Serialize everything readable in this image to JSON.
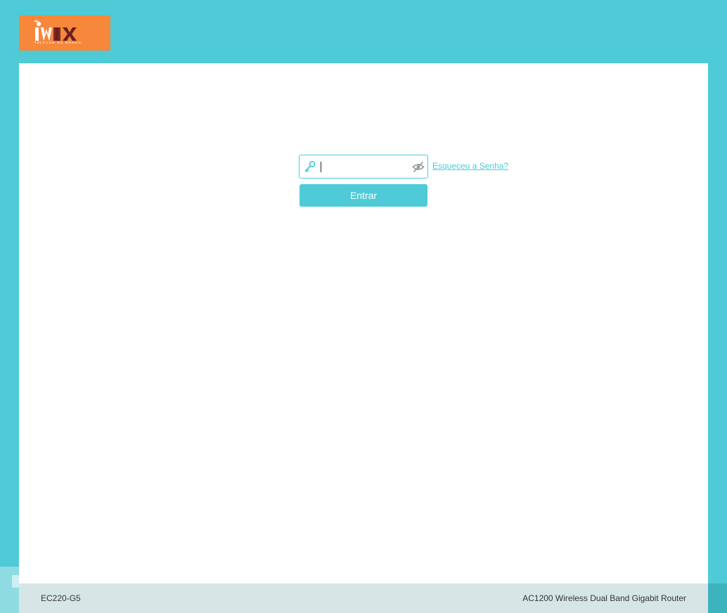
{
  "brand": {
    "logo_text": "IWIX",
    "logo_subtext": "TELECOM DO BRASIL",
    "logo_color": "#f6873b"
  },
  "theme": {
    "accent_color": "#4ecbd6",
    "background_color": "#4ecbd6",
    "panel_color": "#ffffff",
    "footer_color": "#d6e6e7"
  },
  "login": {
    "password_value": "",
    "password_placeholder": "",
    "key_icon": "key-icon",
    "toggle_visibility_icon": "eye-off-icon",
    "forgot_password_link": "Esqueceu a Senha?",
    "submit_label": "Entrar"
  },
  "footer": {
    "model": "EC220-G5",
    "description": "AC1200 Wireless Dual Band Gigabit Router"
  }
}
